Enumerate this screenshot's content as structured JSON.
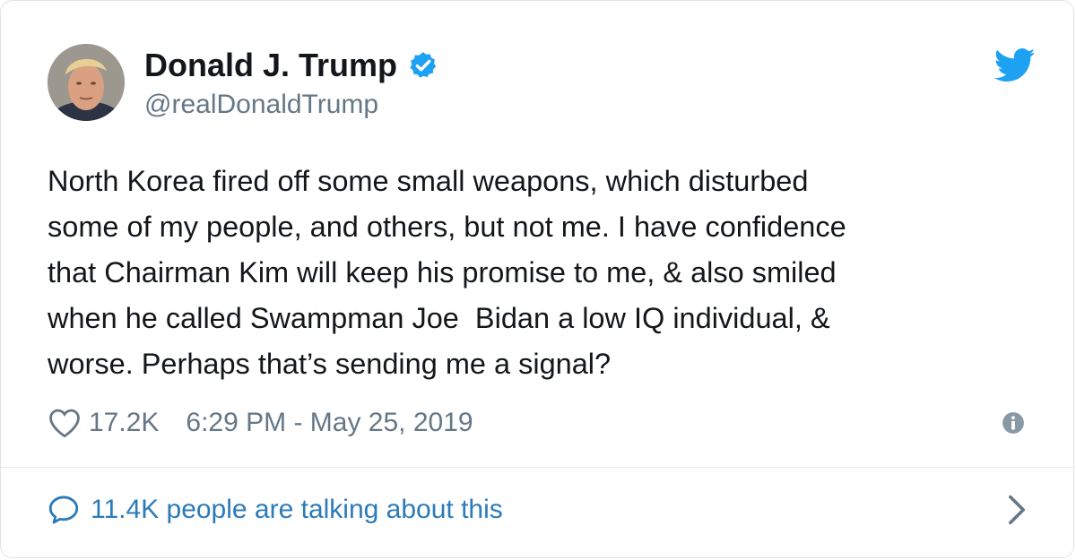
{
  "author": {
    "name": "Donald J. Trump",
    "handle": "@realDonaldTrump",
    "verified": true
  },
  "tweet": {
    "text": "North Korea fired off some small weapons, which disturbed\nsome of my people, and others, but not me. I have confidence\nthat Chairman Kim will keep his promise to me, & also smiled\nwhen he called Swampman Joe  Bidan a low IQ individual, &\nworse. Perhaps that’s sending me a signal?",
    "likes": "17.2K",
    "timestamp": "6:29 PM - May 25, 2019"
  },
  "footer": {
    "talking": "11.4K people are talking about this"
  },
  "colors": {
    "text": "#14171a",
    "secondary": "#657786",
    "link": "#2b7bb9",
    "twitter_blue": "#1da1f2",
    "border": "#e1e8ed"
  },
  "icons": {
    "verified": "verified-badge-icon",
    "brand": "twitter-bird-icon",
    "like": "heart-icon",
    "info": "info-icon",
    "conversation": "speech-bubble-icon",
    "expand": "chevron-right-icon"
  }
}
